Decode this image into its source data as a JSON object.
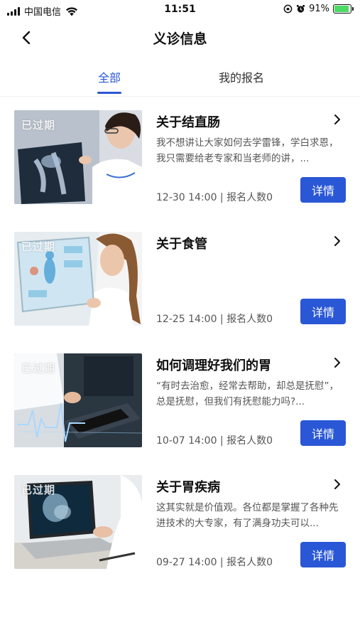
{
  "status_bar": {
    "carrier": "中国电信",
    "time": "11:51",
    "battery_percent": "91%",
    "battery_level": 0.91,
    "icons": [
      "signal-icon",
      "wifi-icon",
      "rotation-lock-icon",
      "alarm-icon",
      "battery-icon"
    ]
  },
  "nav": {
    "title": "义诊信息",
    "back_icon": "back-chevron-icon"
  },
  "tabs": [
    {
      "label": "全部",
      "active": true
    },
    {
      "label": "我的报名",
      "active": false
    }
  ],
  "colors": {
    "accent": "#2a57d6",
    "text_primary": "#111111",
    "text_secondary": "#555555"
  },
  "cards": [
    {
      "status": "已过期",
      "title": "关于结直肠",
      "desc": "我不想讲让大家如何去学雷锋，学白求恩，我只需要给老专家和当老师的讲，...",
      "meta": "12-30 14:00 | 报名人数0",
      "button": "详情"
    },
    {
      "status": "已过期",
      "title": "关于食管",
      "desc": "",
      "meta": "12-25 14:00 | 报名人数0",
      "button": "详情"
    },
    {
      "status": "已过期",
      "title": "如何调理好我们的胃",
      "desc": "“有时去治愈，经常去帮助，却总是抚慰”，总是抚慰，但我们有抚慰能力吗?...",
      "meta": "10-07 14:00 | 报名人数0",
      "button": "详情"
    },
    {
      "status": "已过期",
      "title": "关于胃疾病",
      "desc": "这其实就是价值观。各位都是掌握了各种先进技术的大专家，有了满身功夫可以...",
      "meta": "09-27 14:00 | 报名人数0",
      "button": "详情"
    }
  ]
}
